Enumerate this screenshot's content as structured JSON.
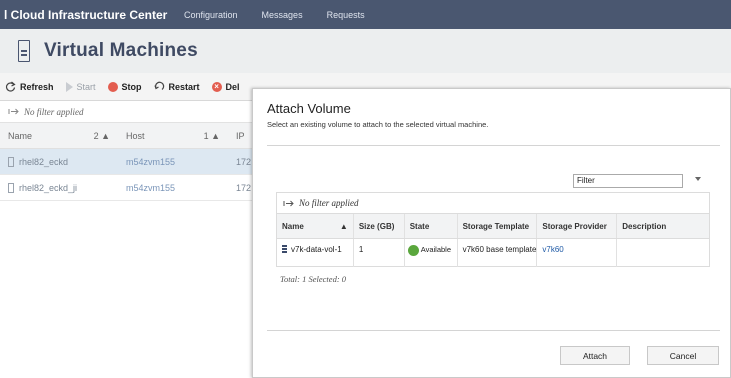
{
  "topbar": {
    "app_title": "l Cloud Infrastructure Center",
    "nav": [
      "Configuration",
      "Messages",
      "Requests"
    ]
  },
  "page": {
    "title": "Virtual Machines"
  },
  "toolbar": {
    "refresh": "Refresh",
    "start": "Start",
    "stop": "Stop",
    "restart": "Restart",
    "delete": "Del"
  },
  "vm_list": {
    "filter_text": "No filter applied",
    "columns": [
      {
        "label": "Name",
        "sort": "2 ▲"
      },
      {
        "label": "Host",
        "sort": "1 ▲"
      },
      {
        "label": "IP",
        "sort": ""
      }
    ],
    "rows": [
      {
        "name": "rhel82_eckd",
        "host": "m54zvm155",
        "ip": "172",
        "selected": true
      },
      {
        "name": "rhel82_eckd_ji",
        "host": "m54zvm155",
        "ip": "172",
        "selected": false
      }
    ]
  },
  "dialog": {
    "title": "Attach Volume",
    "subtitle": "Select an existing volume to attach to the selected virtual machine.",
    "filter_value": "Filter",
    "table": {
      "filter_text": "No filter applied",
      "columns": [
        "Name",
        "Size (GB)",
        "State",
        "Storage Template",
        "Storage Provider",
        "Description"
      ],
      "name_sort": "▲",
      "rows": [
        {
          "name": "v7k-data-vol-1",
          "size": "1",
          "state": "Available",
          "template": "v7k60 base template",
          "provider": "v7k60",
          "description": ""
        }
      ]
    },
    "total_text": "Total: 1 Selected: 0",
    "attach_label": "Attach",
    "cancel_label": "Cancel"
  },
  "colors": {
    "topbar": "#4a5770",
    "accent": "#1f5aa6",
    "stop": "#e35d4f",
    "available": "#5aa73d"
  }
}
